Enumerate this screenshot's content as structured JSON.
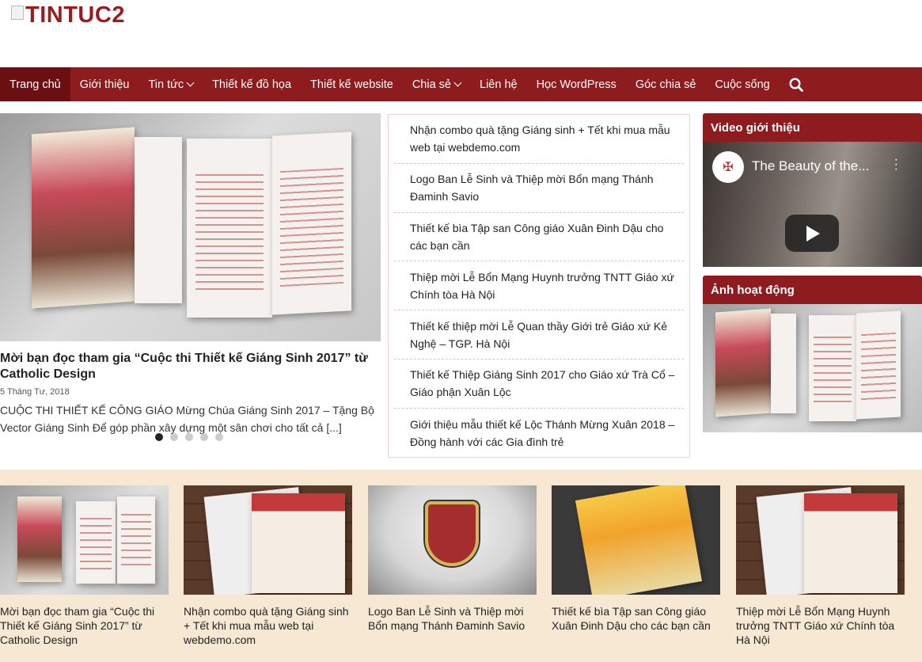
{
  "site": {
    "logo_text": "TINTUC2"
  },
  "nav": {
    "items": [
      {
        "label": "Trang chủ",
        "active": true,
        "dropdown": false
      },
      {
        "label": "Giới thiệu",
        "active": false,
        "dropdown": false
      },
      {
        "label": "Tin tức",
        "active": false,
        "dropdown": true
      },
      {
        "label": "Thiết kế đồ họa",
        "active": false,
        "dropdown": false
      },
      {
        "label": "Thiết kế website",
        "active": false,
        "dropdown": false
      },
      {
        "label": "Chia sẻ",
        "active": false,
        "dropdown": true
      },
      {
        "label": "Liên hệ",
        "active": false,
        "dropdown": false
      },
      {
        "label": "Học WordPress",
        "active": false,
        "dropdown": false
      },
      {
        "label": "Góc chia sẻ",
        "active": false,
        "dropdown": false
      },
      {
        "label": "Cuộc sống",
        "active": false,
        "dropdown": false
      }
    ],
    "search_icon": "search-icon"
  },
  "slider": {
    "title": "Mời bạn đọc tham gia “Cuộc thi Thiết kế Giáng Sinh 2017” từ Catholic Design",
    "date": "5 Tháng Tư, 2018",
    "excerpt": "CUỘC THI THIẾT KẾ CÔNG GIÁO Mừng Chúa Giáng Sinh 2017 – Tặng Bộ Vector Giáng Sinh Để góp phần xây dựng một sân chơi cho tất cả [...]",
    "dots": 5,
    "active_dot": 0
  },
  "post_list": [
    "Nhận combo quà tặng Giáng sinh + Tết khi mua mẫu web tại webdemo.com",
    "Logo Ban Lễ Sinh và Thiệp mời Bổn mạng Thánh Đaminh Savio",
    "Thiết kế bìa Tập san Công giáo Xuân Đinh Dậu cho các bạn cần",
    "Thiệp mời Lễ Bổn Mạng Huynh trưởng TNTT Giáo xứ Chính tòa Hà Nội",
    "Thiết kế thiệp mời Lễ Quan thầy Giới trẻ Giáo xứ Kẻ Nghệ – TGP. Hà Nội",
    "Thiết kế Thiệp Giáng Sinh 2017 cho Giáo xứ Trà Cổ – Giáo phận Xuân Lộc",
    "Giới thiệu mẫu thiết kế Lộc Thánh Mừng Xuân 2018 – Đồng hành với các Gia đình trẻ"
  ],
  "sidebar": {
    "video_widget_title": "Video giới thiệu",
    "video_title": "The Beauty of the...",
    "photo_widget_title": "Ảnh hoạt động"
  },
  "cards": [
    {
      "title": "Mời bạn đọc tham gia “Cuộc thi Thiết kế Giáng Sinh 2017” từ Catholic Design"
    },
    {
      "title": "Nhận combo quà tặng Giáng sinh + Tết khi mua mẫu web tại webdemo.com"
    },
    {
      "title": "Logo Ban Lễ Sinh và Thiệp mời Bổn mạng Thánh Đaminh Savio"
    },
    {
      "title": "Thiết kế bìa Tập san Công giáo Xuân Đinh Dậu cho các bạn cần"
    },
    {
      "title": "Thiệp mời Lễ Bổn Mạng Huynh trưởng TNTT Giáo xứ Chính tòa Hà Nội"
    }
  ],
  "colors": {
    "brand": "#8e1b1e",
    "brand_dark": "#6b0f12",
    "band": "#f6e8d2"
  }
}
